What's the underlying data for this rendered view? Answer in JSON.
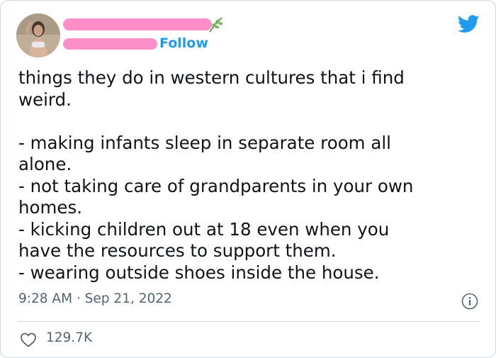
{
  "user": {
    "follow_label": "Follow"
  },
  "tweet": {
    "lines": [
      "things they do in western cultures that i find",
      "weird.",
      "",
      "- making infants sleep in separate room all",
      "alone.",
      "- not taking care of grandparents in your own",
      "homes.",
      "- kicking children out at 18 even when you",
      "have the resources to support them.",
      "- wearing outside shoes inside the house."
    ],
    "timestamp": "9:28 AM · Sep 21, 2022",
    "likes": "129.7K"
  },
  "colors": {
    "accent": "#1d9bf0",
    "redaction": "#ff8fc8",
    "muted_text": "#536471",
    "border": "#cfd9de"
  },
  "icons": {
    "brand": "twitter-bird-icon",
    "info": "info-icon",
    "like": "heart-icon"
  }
}
